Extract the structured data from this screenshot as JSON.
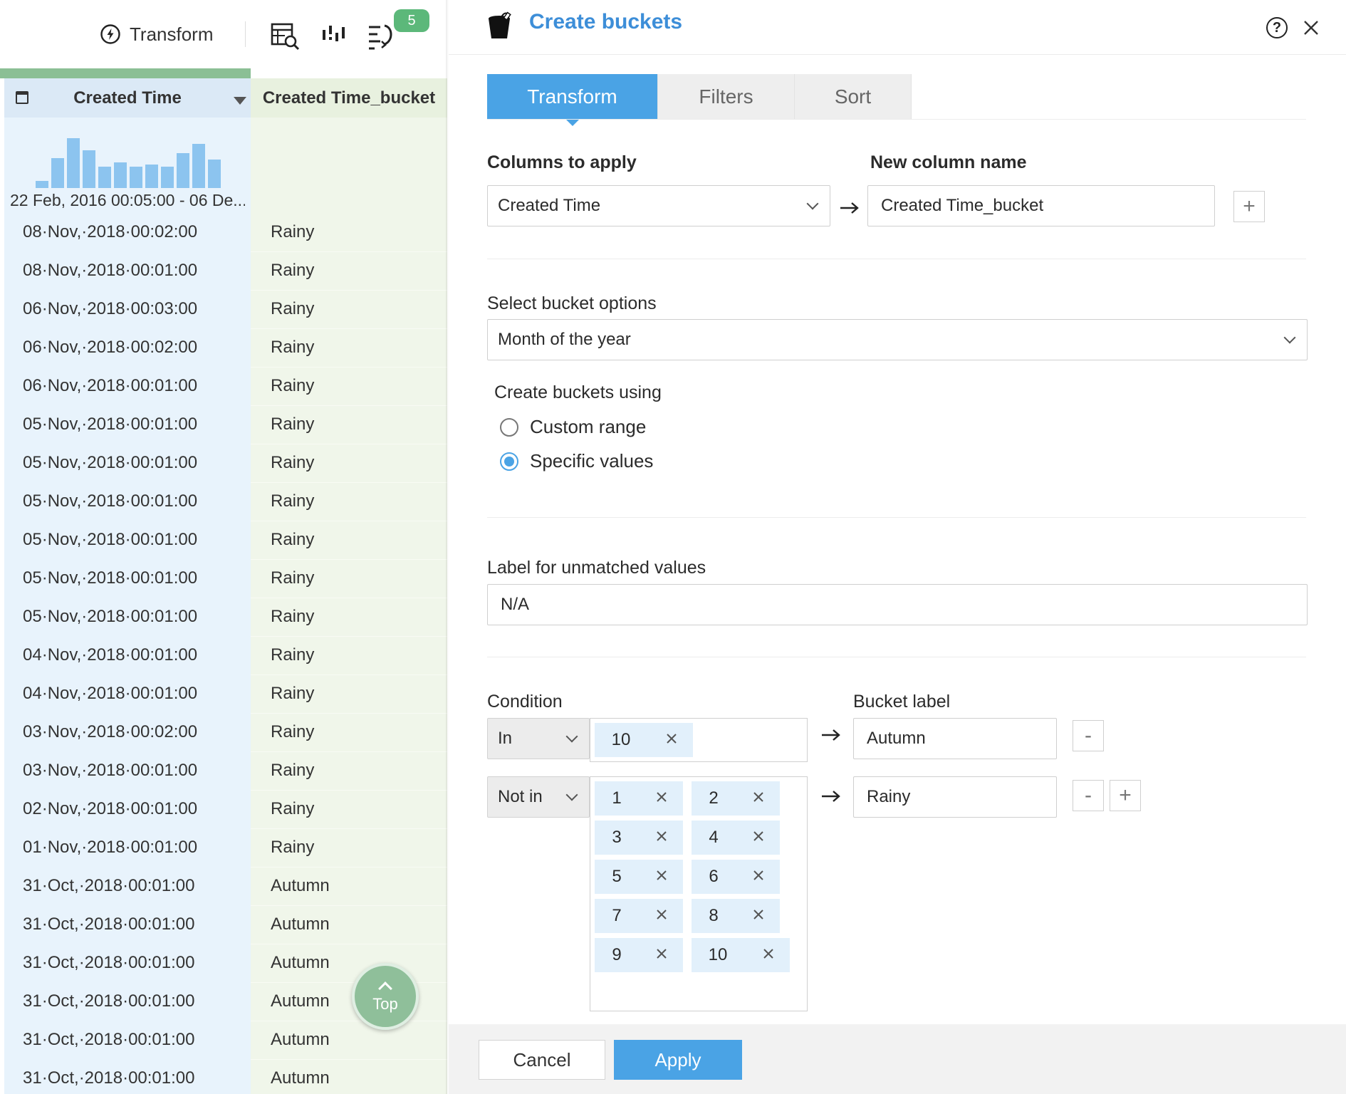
{
  "toolbar": {
    "transform_label": "Transform",
    "badge_count": "5",
    "icons": [
      "lightning-icon",
      "table-search-icon",
      "column-stats-icon",
      "steps-icon"
    ]
  },
  "grid": {
    "created_header": "Created Time",
    "bucket_header": "Created Time_bucket",
    "histogram_levels": [
      0.11,
      0.48,
      0.79,
      0.6,
      0.34,
      0.41,
      0.34,
      0.38,
      0.34,
      0.56,
      0.71,
      0.45
    ],
    "range_label": "22 Feb, 2016 00:05:00 - 06 De...",
    "rows": [
      {
        "time": "08·Nov,·2018·00:02:00",
        "bucket": "Rainy"
      },
      {
        "time": "08·Nov,·2018·00:01:00",
        "bucket": "Rainy"
      },
      {
        "time": "06·Nov,·2018·00:03:00",
        "bucket": "Rainy"
      },
      {
        "time": "06·Nov,·2018·00:02:00",
        "bucket": "Rainy"
      },
      {
        "time": "06·Nov,·2018·00:01:00",
        "bucket": "Rainy"
      },
      {
        "time": "05·Nov,·2018·00:01:00",
        "bucket": "Rainy"
      },
      {
        "time": "05·Nov,·2018·00:01:00",
        "bucket": "Rainy"
      },
      {
        "time": "05·Nov,·2018·00:01:00",
        "bucket": "Rainy"
      },
      {
        "time": "05·Nov,·2018·00:01:00",
        "bucket": "Rainy"
      },
      {
        "time": "05·Nov,·2018·00:01:00",
        "bucket": "Rainy"
      },
      {
        "time": "05·Nov,·2018·00:01:00",
        "bucket": "Rainy"
      },
      {
        "time": "04·Nov,·2018·00:01:00",
        "bucket": "Rainy"
      },
      {
        "time": "04·Nov,·2018·00:01:00",
        "bucket": "Rainy"
      },
      {
        "time": "03·Nov,·2018·00:02:00",
        "bucket": "Rainy"
      },
      {
        "time": "03·Nov,·2018·00:01:00",
        "bucket": "Rainy"
      },
      {
        "time": "02·Nov,·2018·00:01:00",
        "bucket": "Rainy"
      },
      {
        "time": "01·Nov,·2018·00:01:00",
        "bucket": "Rainy"
      },
      {
        "time": "31·Oct,·2018·00:01:00",
        "bucket": "Autumn"
      },
      {
        "time": "31·Oct,·2018·00:01:00",
        "bucket": "Autumn"
      },
      {
        "time": "31·Oct,·2018·00:01:00",
        "bucket": "Autumn"
      },
      {
        "time": "31·Oct,·2018·00:01:00",
        "bucket": "Autumn"
      },
      {
        "time": "31·Oct,·2018·00:01:00",
        "bucket": "Autumn"
      },
      {
        "time": "31·Oct,·2018·00:01:00",
        "bucket": "Autumn"
      }
    ],
    "top_button": "Top"
  },
  "panel": {
    "title": "Create buckets",
    "help": "?",
    "tabs": [
      "Transform",
      "Filters",
      "Sort"
    ],
    "active_tab": "Transform",
    "columns_to_apply_label": "Columns to apply",
    "new_column_name_label": "New column name",
    "column_value": "Created Time",
    "new_column_value": "Created Time_bucket",
    "bucket_options_label": "Select bucket options",
    "bucket_option_value": "Month of the year",
    "create_using_label": "Create buckets using",
    "radio_options": [
      "Custom range",
      "Specific values"
    ],
    "selected_radio": "Specific values",
    "unmatched_label": "Label for unmatched values",
    "unmatched_value": "N/A",
    "condition_label": "Condition",
    "bucket_label_header": "Bucket label",
    "conditions": [
      {
        "operator": "In",
        "values": [
          "10"
        ],
        "label": "Autumn"
      },
      {
        "operator": "Not in",
        "values": [
          "1",
          "2",
          "3",
          "4",
          "5",
          "6",
          "7",
          "8",
          "9",
          "10"
        ],
        "label": "Rainy"
      }
    ],
    "minus": "-",
    "plus": "+",
    "cancel": "Cancel",
    "apply": "Apply"
  },
  "colors": {
    "accent": "#4aa3e5",
    "title_blue": "#3d8ed8",
    "badge_green": "#5cb87a",
    "created_col_bg": "#e8f3fc",
    "bucket_col_bg": "#f0f6ea",
    "histogram_bar": "#8cc4ef"
  }
}
